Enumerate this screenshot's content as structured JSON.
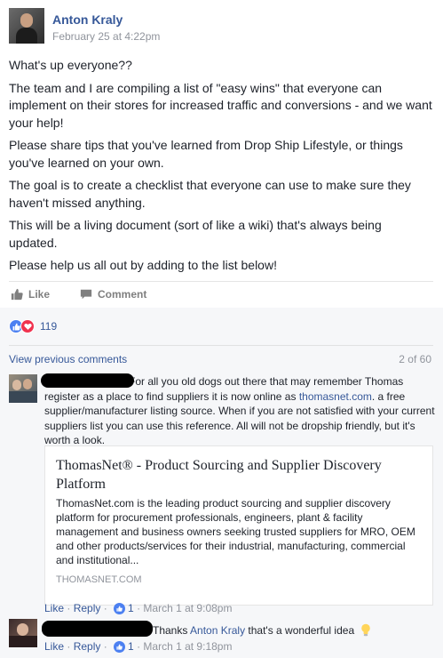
{
  "post": {
    "author": "Anton Kraly",
    "timestamp": "February 25 at 4:22pm",
    "paragraphs": [
      "What's up everyone??",
      "The team and I are compiling a list of \"easy wins\" that everyone can implement on their stores for increased traffic and conversions - and we want your help!",
      "Please share tips that you've learned from Drop Ship Lifestyle, or things you've learned on your own.",
      "The goal is to create a checklist that everyone can use to make sure they haven't missed anything.",
      "This will be a living document (sort of like a wiki) that's always being updated.",
      "Please help us all out by adding to the list below!"
    ]
  },
  "actions": {
    "like_label": "Like",
    "comment_label": "Comment"
  },
  "reactions": {
    "count": "119",
    "like_color": "#4c80f1",
    "love_color": "#f0334f"
  },
  "comments_nav": {
    "view_previous": "View previous comments",
    "pager": "2 of 60"
  },
  "comments": [
    {
      "text_before_link": "For all you old dogs out there that may remember Thomas register as a place to find suppliers it is now online as ",
      "link_text": "thomasnet.com",
      "text_after_link": ". a free supplier/manufacturer listing source. When if you are not satisfied with your current suppliers list you can use this reference. All will not be dropship friendly, but it's worth a look.",
      "card": {
        "title": "ThomasNet® - Product Sourcing and Supplier Discovery Platform",
        "description": "ThomasNet.com is the leading product sourcing and supplier discovery platform for procurement professionals, engineers, plant & facility management and business owners seeking trusted suppliers for MRO, OEM and other products/services for their industrial, manufacturing, commercial and institutional...",
        "domain": "THOMASNET.COM"
      },
      "meta": {
        "like": "Like",
        "sep1": " · ",
        "reply": "Reply",
        "sep2": " · ",
        "like_count": "1",
        "sep3": " · ",
        "time": "March 1 at 9:08pm"
      }
    },
    {
      "text_before_mention": "Thanks ",
      "mention": "Anton Kraly",
      "text_after_mention": " that's a wonderful idea",
      "meta": {
        "like": "Like",
        "sep1": " · ",
        "reply": "Reply",
        "sep2": " · ",
        "like_count": "1",
        "sep3": " · ",
        "time": "March 1 at 9:18pm"
      }
    }
  ]
}
